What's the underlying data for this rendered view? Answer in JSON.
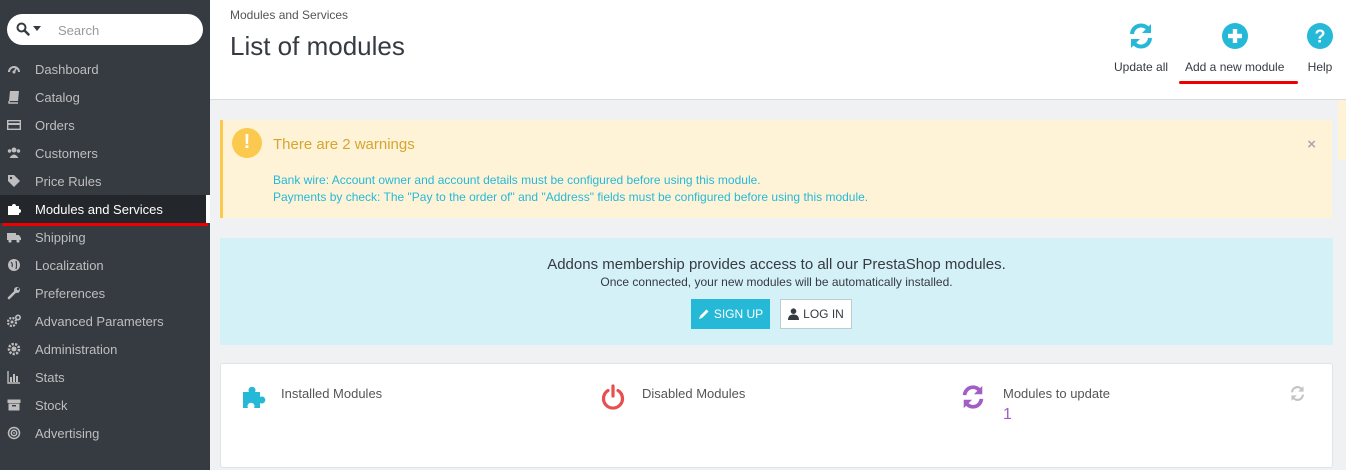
{
  "sidebar": {
    "search_placeholder": "Search",
    "items": [
      {
        "label": "Dashboard",
        "icon": "dashboard-icon"
      },
      {
        "label": "Catalog",
        "icon": "book-icon"
      },
      {
        "label": "Orders",
        "icon": "credit-card-icon"
      },
      {
        "label": "Customers",
        "icon": "users-icon"
      },
      {
        "label": "Price Rules",
        "icon": "tags-icon"
      },
      {
        "label": "Modules and Services",
        "icon": "puzzle-icon",
        "active": true
      },
      {
        "label": "Shipping",
        "icon": "truck-icon"
      },
      {
        "label": "Localization",
        "icon": "globe-icon"
      },
      {
        "label": "Preferences",
        "icon": "wrench-icon"
      },
      {
        "label": "Advanced Parameters",
        "icon": "cogs-icon"
      },
      {
        "label": "Administration",
        "icon": "gear-icon"
      },
      {
        "label": "Stats",
        "icon": "bar-chart-icon"
      },
      {
        "label": "Stock",
        "icon": "archive-icon"
      },
      {
        "label": "Advertising",
        "icon": "bullseye-icon"
      }
    ]
  },
  "header": {
    "breadcrumb": "Modules and Services",
    "title": "List of modules",
    "toolbar": {
      "update_all": "Update all",
      "add_module": "Add a new module",
      "help": "Help"
    }
  },
  "warning": {
    "title": "There are 2 warnings",
    "messages": [
      "Bank wire: Account owner and account details must be configured before using this module.",
      "Payments by check: The \"Pay to the order of\" and \"Address\" fields must be configured before using this module."
    ],
    "close": "×"
  },
  "addons": {
    "title": "Addons membership provides access to all our PrestaShop modules.",
    "subtitle": "Once connected, your new modules will be automatically installed.",
    "signup": "SIGN UP",
    "login": "LOG IN"
  },
  "stats": {
    "installed": {
      "label": "Installed Modules"
    },
    "disabled": {
      "label": "Disabled Modules"
    },
    "to_update": {
      "label": "Modules to update",
      "value": "1"
    }
  },
  "colors": {
    "sidebar_bg": "#363a41",
    "accent": "#25b9d7",
    "warning_bg": "#fff3d7",
    "info_bg": "#d4f1f7",
    "update_purple": "#a15fc5",
    "disabled_red": "#e84e4e",
    "highlight_red": "#e00000"
  }
}
